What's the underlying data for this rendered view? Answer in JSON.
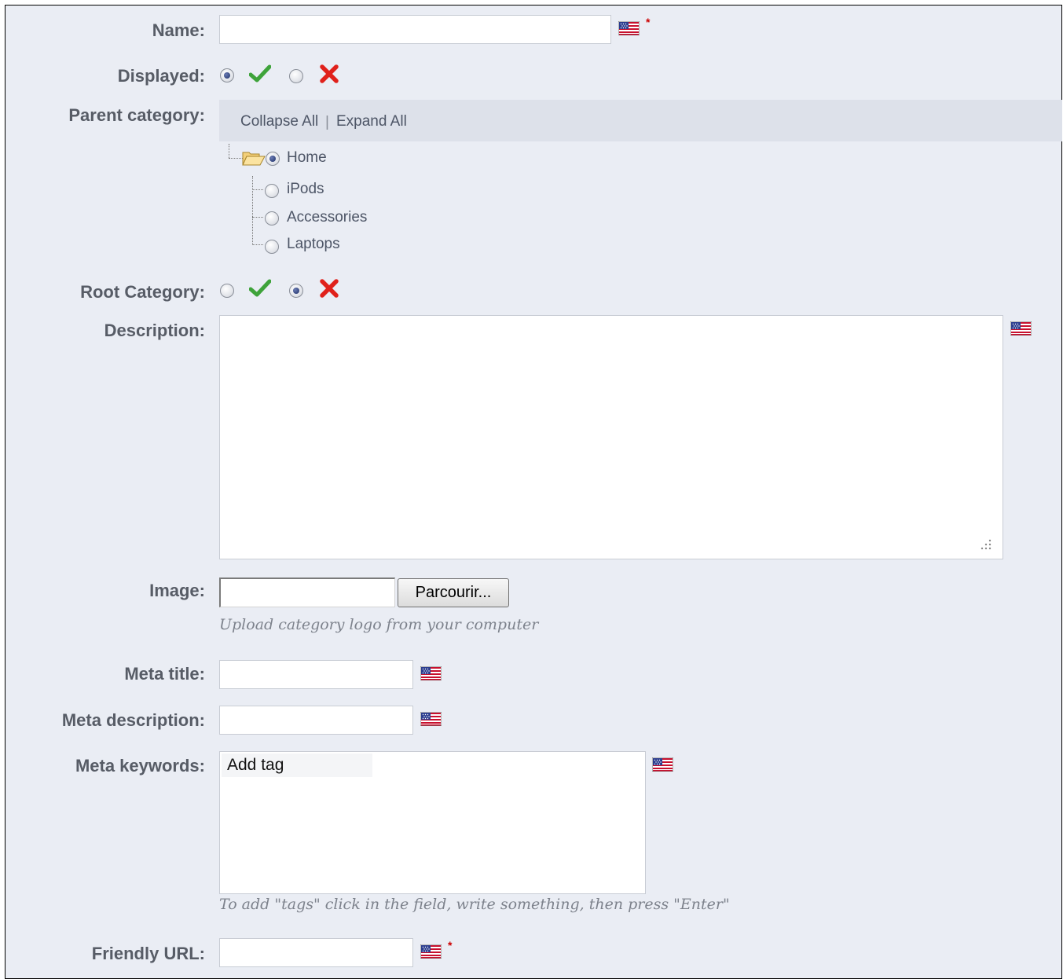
{
  "form": {
    "name": {
      "label": "Name:",
      "value": "",
      "required_mark": "*"
    },
    "displayed": {
      "label": "Displayed:",
      "selected": "yes"
    },
    "parent_category": {
      "label": "Parent category:",
      "collapse_all": "Collapse All",
      "separator": "|",
      "expand_all": "Expand All",
      "tree": {
        "root": {
          "label": "Home",
          "selected": true
        },
        "children": [
          {
            "label": "iPods",
            "selected": false
          },
          {
            "label": "Accessories",
            "selected": false
          },
          {
            "label": "Laptops",
            "selected": false
          }
        ]
      }
    },
    "root_category": {
      "label": "Root Category:",
      "selected": "no"
    },
    "description": {
      "label": "Description:",
      "value": ""
    },
    "image": {
      "label": "Image:",
      "browse_button": "Parcourir...",
      "help": "Upload category logo from your computer"
    },
    "meta_title": {
      "label": "Meta title:",
      "value": ""
    },
    "meta_description": {
      "label": "Meta description:",
      "value": ""
    },
    "meta_keywords": {
      "label": "Meta keywords:",
      "placeholder": "Add tag",
      "help": "To add \"tags\" click in the field, write something, then press \"Enter\""
    },
    "friendly_url": {
      "label": "Friendly URL:",
      "value": "",
      "required_mark": "*"
    }
  },
  "icons": {
    "language_flag": "us-flag-icon",
    "yes": "check-icon",
    "no": "cross-icon",
    "folder": "folder-open-icon"
  },
  "colors": {
    "background": "#eaedf4",
    "label": "#575c66",
    "check": "#3ea33a",
    "cross": "#e0211b",
    "required": "#cc0000"
  }
}
